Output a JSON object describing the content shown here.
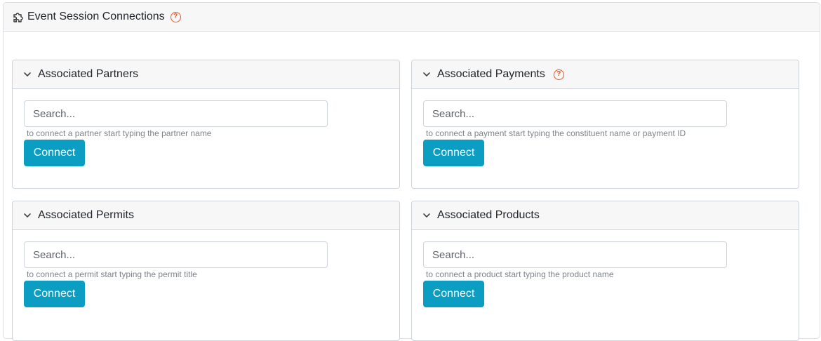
{
  "header": {
    "title": "Event Session Connections",
    "icon": "puzzle-icon",
    "help_icon": "question-circle-icon",
    "help_glyph": "?"
  },
  "colors": {
    "accent": "#0c9ec2",
    "help": "#e2551f",
    "header_bg": "#f7f7f8"
  },
  "panels": [
    {
      "title": "Associated Partners",
      "search_placeholder": "Search...",
      "hint": "to connect a partner start typing the partner name",
      "button": "Connect",
      "has_help": false
    },
    {
      "title": "Associated Payments",
      "search_placeholder": "Search...",
      "hint": "to connect a payment start typing the constituent name or payment ID",
      "button": "Connect",
      "has_help": true
    },
    {
      "title": "Associated Permits",
      "search_placeholder": "Search...",
      "hint": "to connect a permit start typing the permit title",
      "button": "Connect",
      "has_help": false
    },
    {
      "title": "Associated Products",
      "search_placeholder": "Search...",
      "hint": "to connect a product start typing the product name",
      "button": "Connect",
      "has_help": false
    }
  ]
}
